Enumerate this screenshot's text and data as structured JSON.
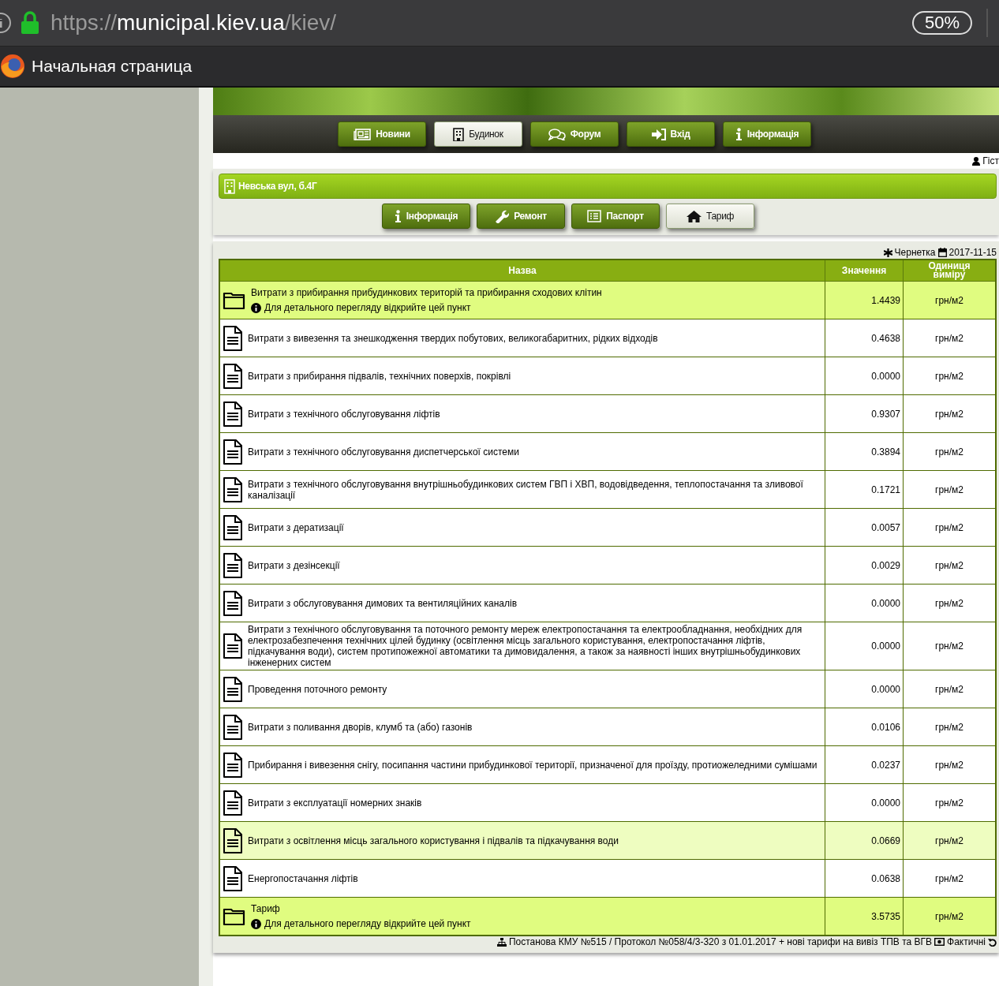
{
  "browser": {
    "url": {
      "scheme": "https://",
      "host": "municipal.kiev.ua",
      "path": "/kiev/"
    },
    "zoom": "50%",
    "tab_title": "Начальная страница"
  },
  "nav": [
    {
      "label": "Новини",
      "selected": false
    },
    {
      "label": "Будинок",
      "selected": true
    },
    {
      "label": "Форум",
      "selected": false
    },
    {
      "label": "Вхід",
      "selected": false
    },
    {
      "label": "Інформація",
      "selected": false
    }
  ],
  "user": "Гіст",
  "house": {
    "title": "Невська вул, б.4Г"
  },
  "house_tabs": [
    {
      "label": "Інформація",
      "selected": false
    },
    {
      "label": "Ремонт",
      "selected": false
    },
    {
      "label": "Паспорт",
      "selected": false
    },
    {
      "label": "Тариф",
      "selected": true
    }
  ],
  "status": {
    "label": "Чернетка",
    "date": "2017-11-15"
  },
  "table": {
    "columns": [
      "Назва",
      "Значення",
      "Одиниця виміру"
    ],
    "rows": [
      {
        "kind": "folder",
        "name": "Витрати з прибирання прибудинкових територій та прибирання сходових клітин",
        "hint": "Для детального перегляду відкрийте цей пункт",
        "value": "1.4439",
        "unit": "грн/м2",
        "hovered": false
      },
      {
        "kind": "doc",
        "name": "Витрати з вивезення та знешкодження твердих побутових, великогабаритних, рідких відходів",
        "value": "0.4638",
        "unit": "грн/м2",
        "hovered": false
      },
      {
        "kind": "doc",
        "name": "Витрати з прибирання підвалів, технічних поверхів, покрівлі",
        "value": "0.0000",
        "unit": "грн/м2",
        "hovered": false
      },
      {
        "kind": "doc",
        "name": "Витрати з технічного обслуговування ліфтів",
        "value": "0.9307",
        "unit": "грн/м2",
        "hovered": false
      },
      {
        "kind": "doc",
        "name": "Витрати з технічного обслуговування диспетчерської системи",
        "value": "0.3894",
        "unit": "грн/м2",
        "hovered": false
      },
      {
        "kind": "doc",
        "name": "Витрати з технічного обслуговування внутрішньобудинкових систем ГВП і ХВП, водовідведення, теплопостачання та зливової каналізації",
        "value": "0.1721",
        "unit": "грн/м2",
        "hovered": false
      },
      {
        "kind": "doc",
        "name": "Витрати з дератизації",
        "value": "0.0057",
        "unit": "грн/м2",
        "hovered": false
      },
      {
        "kind": "doc",
        "name": "Витрати з дезінсекції",
        "value": "0.0029",
        "unit": "грн/м2",
        "hovered": false
      },
      {
        "kind": "doc",
        "name": "Витрати з обслуговування димових та вентиляційних каналів",
        "value": "0.0000",
        "unit": "грн/м2",
        "hovered": false
      },
      {
        "kind": "doc",
        "name": "Витрати з технічного обслуговування та поточного ремонту мереж електропостачання та електрообладнання, необхідних для електрозабезпечення технічних цілей будинку (освітлення місць загального користування, електропостачання ліфтів, підкачування води), систем протипожежної автоматики та димовидалення, а також за наявності інших внутрішньобудинкових інженерних систем",
        "value": "0.0000",
        "unit": "грн/м2",
        "hovered": false
      },
      {
        "kind": "doc",
        "name": "Проведення поточного ремонту",
        "value": "0.0000",
        "unit": "грн/м2",
        "hovered": false
      },
      {
        "kind": "doc",
        "name": "Витрати з поливання дворів, клумб та (або) газонів",
        "value": "0.0106",
        "unit": "грн/м2",
        "hovered": false
      },
      {
        "kind": "doc",
        "name": "Прибирання і вивезення снігу, посипання частини прибудинкової території, призначеної для проїзду, протиожеледними сумішами",
        "value": "0.0237",
        "unit": "грн/м2",
        "hovered": false
      },
      {
        "kind": "doc",
        "name": "Витрати з експлуатації номерних знаків",
        "value": "0.0000",
        "unit": "грн/м2",
        "hovered": false
      },
      {
        "kind": "doc",
        "name": "Витрати з освітлення місць загального користування і підвалів та підкачування води",
        "value": "0.0669",
        "unit": "грн/м2",
        "hovered": true
      },
      {
        "kind": "doc",
        "name": "Енергопостачання ліфтів",
        "value": "0.0638",
        "unit": "грн/м2",
        "hovered": false
      },
      {
        "kind": "folder",
        "name": "Тариф",
        "hint": "Для детального перегляду відкрийте цей пункт",
        "value": "3.5735",
        "unit": "грн/м2",
        "hovered": false
      }
    ]
  },
  "footer": {
    "basis": "Постанова КМУ №515 / Протокол №058/4/3-320 з 01.01.2017 + нові тарифи на вивіз ТПВ та ВГВ",
    "actual": "Фактичні"
  }
}
